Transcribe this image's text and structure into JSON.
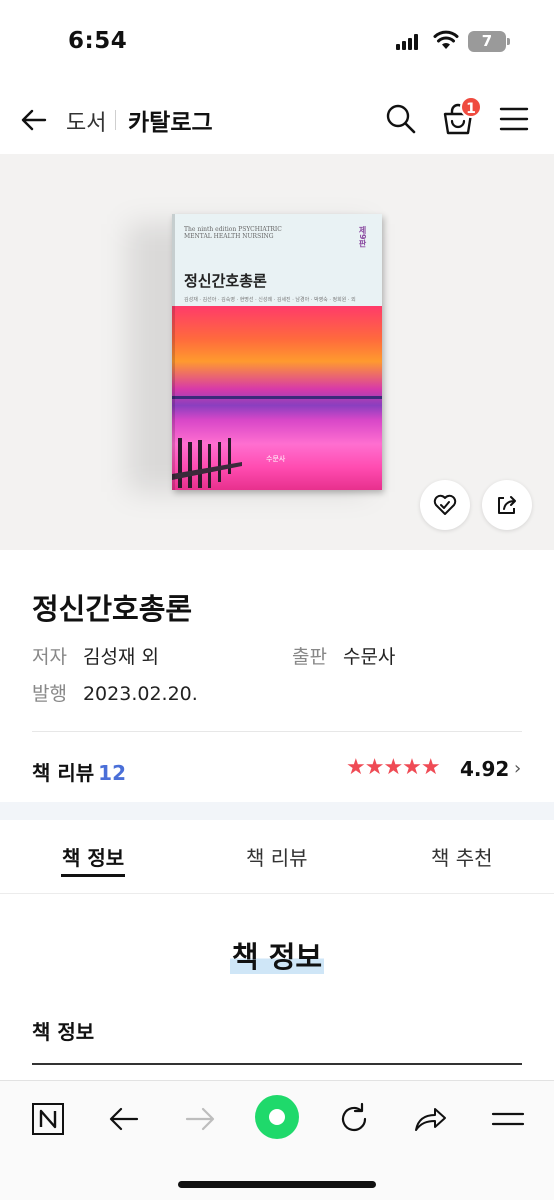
{
  "status_bar": {
    "time": "6:54",
    "battery": "7"
  },
  "header": {
    "breadcrumb": "도서",
    "title": "카탈로그",
    "cart_count": "1"
  },
  "book_cover": {
    "english_subtitle": "The ninth edition PSYCHIATRIC MENTAL HEALTH NURSING",
    "title": "정신간호총론",
    "edition": "제9판",
    "authors_line": "김성재 · 김선아 · 김숙영 · 현명선 · 신성례 · 김세진 · 남경아 · 박영숙 · 정희원 · 외",
    "publisher_logo": "수문사"
  },
  "book": {
    "title": "정신간호총론",
    "author_label": "저자",
    "author": "김성재 외",
    "publisher_label": "출판",
    "publisher": "수문사",
    "date_label": "발행",
    "date": "2023.02.20.",
    "review_label": "책 리뷰",
    "review_count": "12",
    "stars": "★★★★★",
    "rating": "4.92"
  },
  "tabs": [
    {
      "label": "책 정보",
      "active": true
    },
    {
      "label": "책 리뷰",
      "active": false
    },
    {
      "label": "책 추천",
      "active": false
    }
  ],
  "section": {
    "title": "책 정보",
    "subtitle": "책 정보"
  },
  "colors": {
    "accent_red": "#ef4b3f",
    "star_red": "#ef4b55",
    "link_blue": "#4a6fd8",
    "home_green": "#1fd96b"
  },
  "icons": [
    "back-arrow-icon",
    "search-icon",
    "bag-icon",
    "hamburger-menu-icon",
    "heart-check-icon",
    "share-icon",
    "naver-n-icon",
    "browser-back-icon",
    "browser-forward-icon",
    "home-dot-icon",
    "reload-icon",
    "browser-share-icon",
    "browser-menu-icon"
  ]
}
